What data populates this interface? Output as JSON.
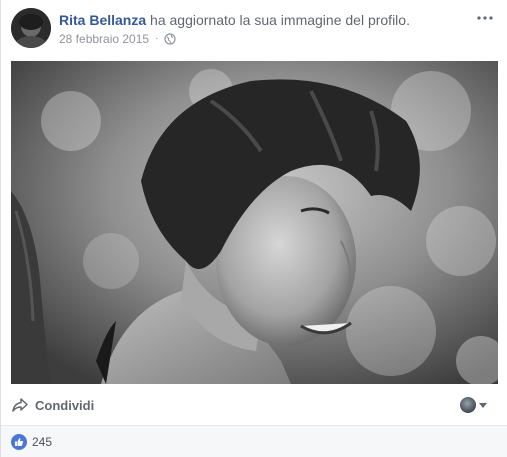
{
  "post": {
    "author": "Rita Bellanza",
    "action": " ha aggiornato la sua immagine del profilo.",
    "date": "28 febbraio 2015",
    "separator": "·",
    "privacy_icon": "globe-icon"
  },
  "photo": {
    "icon": "profile-photo"
  },
  "actions": {
    "share_label": "Condividi",
    "share_icon": "share-arrow-icon",
    "audience_icon": "audience-avatar-icon"
  },
  "reactions": {
    "like_count": "245",
    "icon": "thumbs-up-icon",
    "color": "#4b76d9"
  },
  "colors": {
    "author_link": "#365899",
    "meta_text": "#90949c",
    "footer_bg": "#f6f7f9"
  }
}
